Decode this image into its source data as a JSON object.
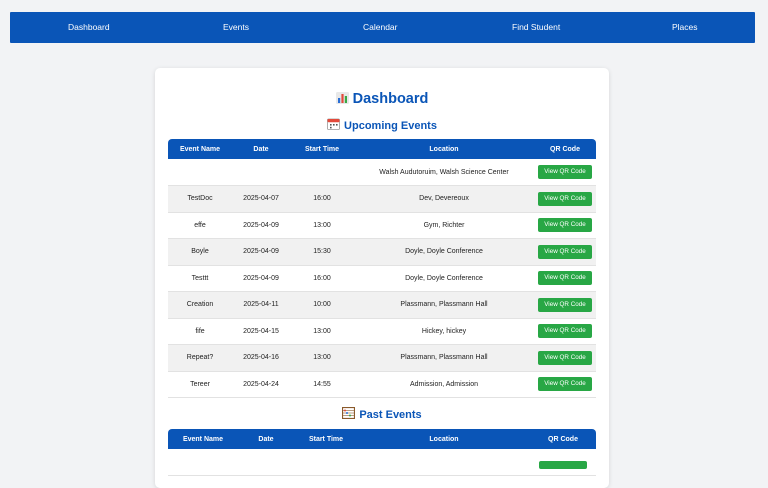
{
  "nav": {
    "items": [
      {
        "label": "Dashboard"
      },
      {
        "label": "Events"
      },
      {
        "label": "Calendar"
      },
      {
        "label": "Find Student"
      },
      {
        "label": "Places"
      }
    ]
  },
  "page": {
    "title": "Dashboard",
    "upcoming_heading": "Upcoming Events",
    "past_heading": "Past Events"
  },
  "columns": [
    "Event Name",
    "Date",
    "Start Time",
    "Location",
    "QR Code"
  ],
  "upcoming": [
    {
      "name": "",
      "date": "",
      "time": "",
      "location": "Walsh Audutoruim, Walsh Science Center",
      "qr": "View QR Code"
    },
    {
      "name": "TestDoc",
      "date": "2025-04-07",
      "time": "16:00",
      "location": "Dev, Devereoux",
      "qr": "View QR Code"
    },
    {
      "name": "effe",
      "date": "2025-04-09",
      "time": "13:00",
      "location": "Gym, Richter",
      "qr": "View QR Code"
    },
    {
      "name": "Boyle",
      "date": "2025-04-09",
      "time": "15:30",
      "location": "Doyle, Doyle Conference",
      "qr": "View QR Code"
    },
    {
      "name": "Testtt",
      "date": "2025-04-09",
      "time": "16:00",
      "location": "Doyle, Doyle Conference",
      "qr": "View QR Code"
    },
    {
      "name": "Creation",
      "date": "2025-04-11",
      "time": "10:00",
      "location": "Plassmann, Plassmann Hall",
      "qr": "View QR Code"
    },
    {
      "name": "fife",
      "date": "2025-04-15",
      "time": "13:00",
      "location": "Hickey, hickey",
      "qr": "View QR Code"
    },
    {
      "name": "Repeat?",
      "date": "2025-04-16",
      "time": "13:00",
      "location": "Plassmann, Plassmann Hall",
      "qr": "View QR Code"
    },
    {
      "name": "Tereer",
      "date": "2025-04-24",
      "time": "14:55",
      "location": "Admission, Admission",
      "qr": "View QR Code"
    }
  ],
  "colors": {
    "primary": "#0a55b7",
    "button": "#28a745",
    "background": "#f2f3f5"
  },
  "icons": {
    "title": "bar-chart-icon",
    "upcoming": "calendar-icon",
    "past": "abacus-icon"
  }
}
